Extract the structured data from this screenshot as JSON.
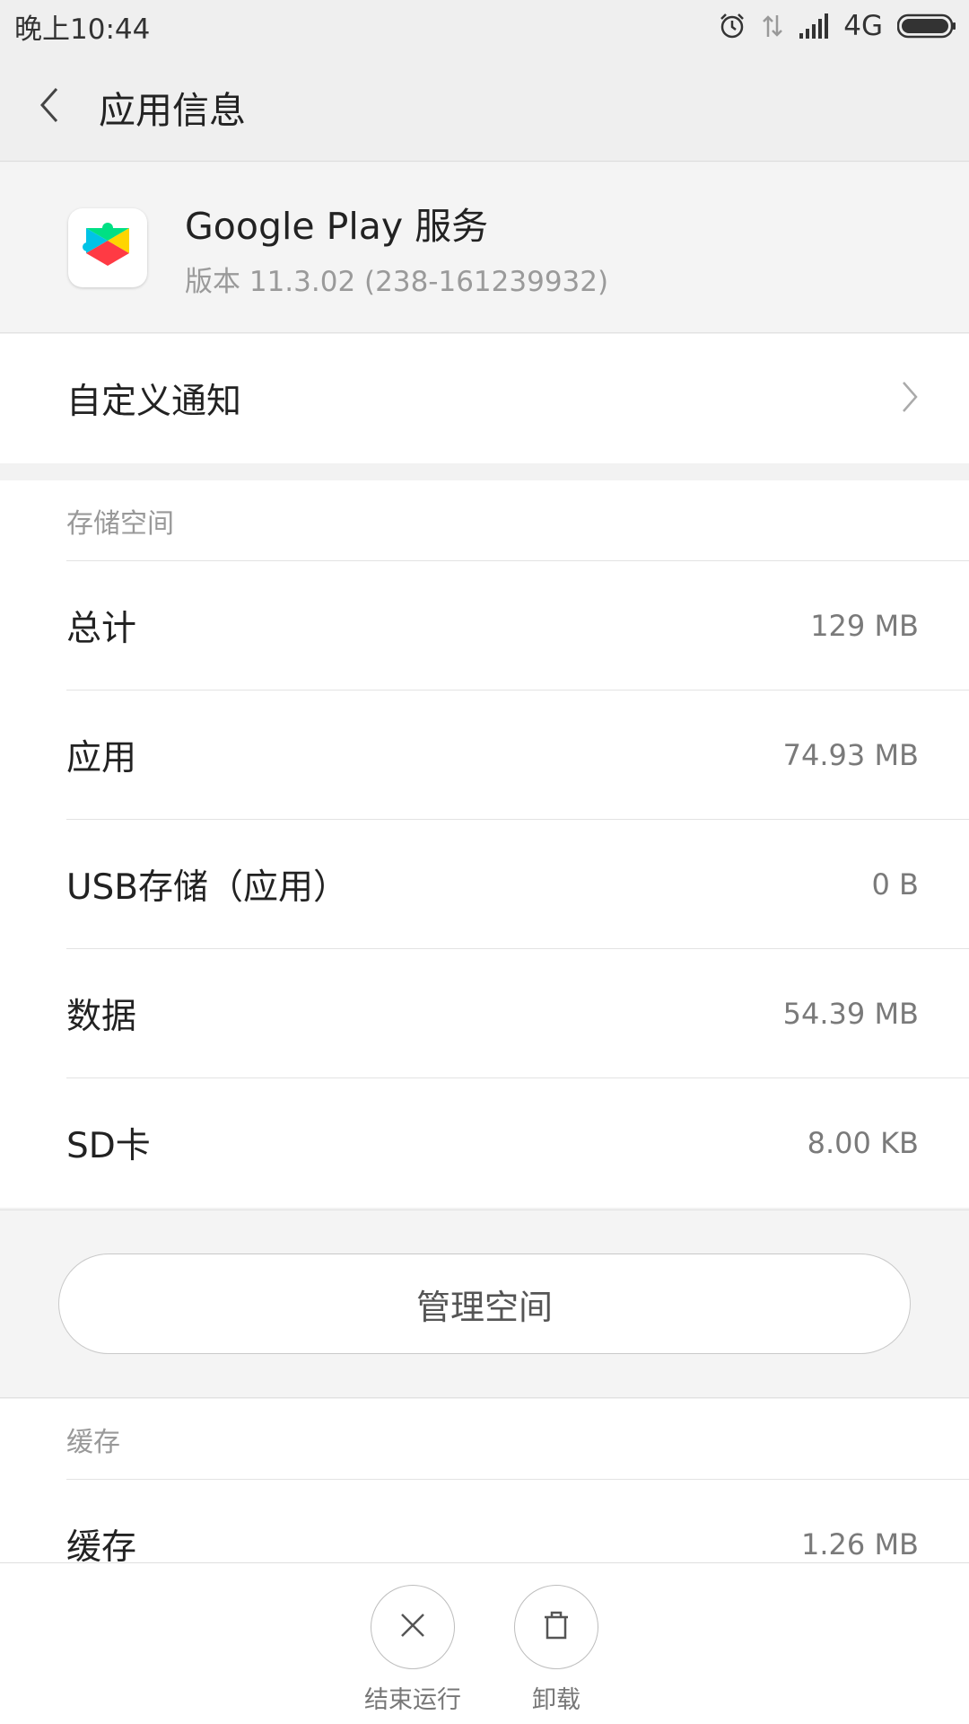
{
  "status_bar": {
    "time": "晚上10:44",
    "network": "4G",
    "icons": [
      "alarm-icon",
      "data-arrows-icon",
      "signal-icon",
      "battery-icon"
    ]
  },
  "header": {
    "title": "应用信息",
    "back_icon": "chevron-left-icon"
  },
  "app": {
    "name": "Google Play 服务",
    "version": "版本 11.3.02 (238-161239932)",
    "icon": "google-play-services-icon"
  },
  "notifications": {
    "label": "自定义通知"
  },
  "storage": {
    "section_title": "存储空间",
    "rows": [
      {
        "label": "总计",
        "value": "129 MB"
      },
      {
        "label": "应用",
        "value": "74.93 MB"
      },
      {
        "label": "USB存储（应用）",
        "value": "0 B"
      },
      {
        "label": "数据",
        "value": "54.39 MB"
      },
      {
        "label": "SD卡",
        "value": "8.00 KB"
      }
    ],
    "manage_button": "管理空间"
  },
  "cache": {
    "section_title": "缓存",
    "rows": [
      {
        "label": "缓存",
        "value": "1.26 MB"
      }
    ]
  },
  "actions": [
    {
      "label": "结束运行",
      "icon": "close-icon"
    },
    {
      "label": "卸载",
      "icon": "trash-icon"
    }
  ],
  "colors": {
    "background": "#f2f2f2",
    "text_primary": "#222222",
    "text_secondary": "#999999"
  }
}
